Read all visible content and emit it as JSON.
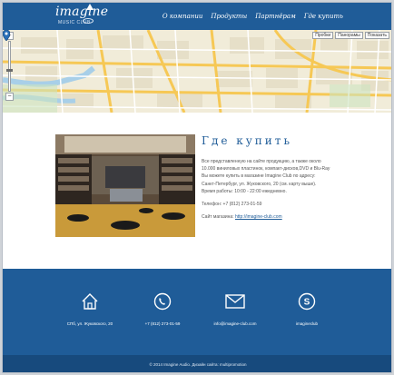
{
  "header": {
    "logo_text": "imagine",
    "logo_subtitle": "MUSIC CLUB",
    "nav": [
      "О компании",
      "Продукты",
      "Партнёрам",
      "Где купить"
    ]
  },
  "map": {
    "tools": [
      "Пробки",
      "Панорамы",
      "Показать"
    ],
    "zoom_in": "+",
    "zoom_out": "−"
  },
  "content": {
    "title": "Где купить",
    "paragraphs": [
      "Все представленную на сайте продукцию, а также около",
      "10.000 виниловых пластинок, компакт-дисков,DVD и Blu-Ray",
      "Вы можете купить в магазине Imagine Club по адресу:",
      "Санкт-Петербург, ул. Жуковского, 20 (см. карту выше).",
      "Время работы: 10:00 - 22:00 ежедневно."
    ],
    "phone": "Телефон: +7 (812) 273-01-59",
    "site_label": "Сайт магазина:",
    "site_url": "http://imagine-club.com"
  },
  "footer": {
    "items": [
      {
        "icon": "home-icon",
        "label": "СПб, ул. Жуковского, 20"
      },
      {
        "icon": "phone-icon",
        "label": "+7 (812) 273-01-59"
      },
      {
        "icon": "mail-icon",
        "label": "info@imagine-club.com"
      },
      {
        "icon": "skype-icon",
        "label": "imagineclub"
      }
    ],
    "copyright": "© 2014 Imagine Audio. Дизайн сайта: multipromotion"
  },
  "colors": {
    "brand_blue": "#1f5c98",
    "footer_dark": "#174a7d",
    "map_base": "#f1ecd9",
    "map_road": "#f6c855"
  }
}
